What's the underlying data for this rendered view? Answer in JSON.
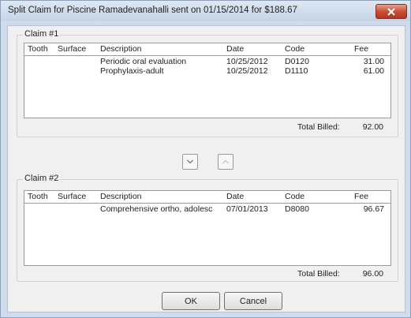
{
  "window": {
    "title": "Split Claim for Piscine Ramadevanahalli sent on 01/15/2014 for $188.67"
  },
  "columns": [
    "Tooth",
    "Surface",
    "Description",
    "Date",
    "Code",
    "Fee"
  ],
  "claim1": {
    "label": "Claim #1",
    "rows": [
      {
        "tooth": "",
        "surface": "",
        "description": "Periodic oral evaluation",
        "date": "10/25/2012",
        "code": "D0120",
        "fee": "31.00"
      },
      {
        "tooth": "",
        "surface": "",
        "description": "Prophylaxis-adult",
        "date": "10/25/2012",
        "code": "D1110",
        "fee": "61.00"
      }
    ],
    "total_label": "Total Billed:",
    "total": "92.00"
  },
  "claim2": {
    "label": "Claim #2",
    "rows": [
      {
        "tooth": "",
        "surface": "",
        "description": "Comprehensive ortho, adolesc",
        "date": "07/01/2013",
        "code": "D8080",
        "fee": "96.67"
      }
    ],
    "total_label": "Total Billed:",
    "total": "96.00"
  },
  "buttons": {
    "ok": "OK",
    "cancel": "Cancel"
  },
  "icons": {
    "close": "close-icon",
    "move_down": "chevron-down-icon",
    "move_up": "chevron-up-icon"
  }
}
